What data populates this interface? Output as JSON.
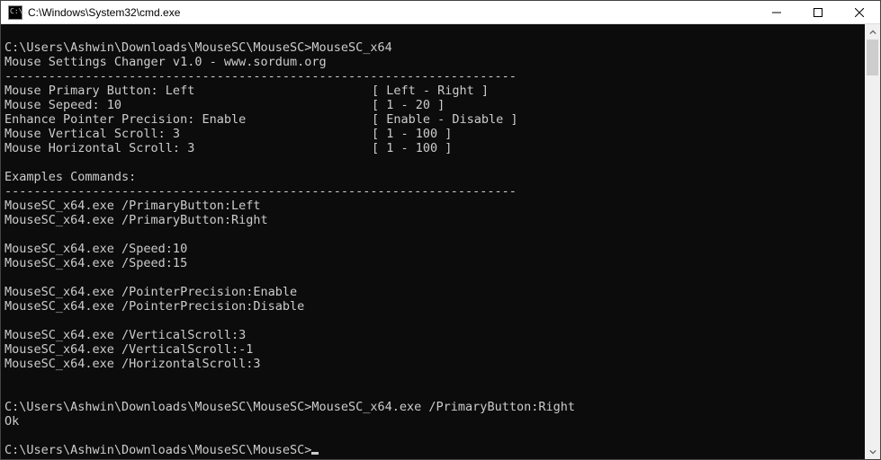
{
  "window": {
    "title": "C:\\Windows\\System32\\cmd.exe",
    "icon_glyph": "C:\\."
  },
  "console": {
    "prompt_path": "C:\\Users\\Ashwin\\Downloads\\MouseSC\\MouseSC>",
    "cmd1": "MouseSC_x64",
    "app_header": "Mouse Settings Changer v1.0 - www.sordum.org",
    "sep": "----------------------------------------------------------------------",
    "settings": {
      "primary": {
        "label": "Mouse Primary Button: Left",
        "range": "[ Left - Right ]"
      },
      "speed": {
        "label": "Mouse Sepeed: 10",
        "range": "[ 1 - 20 ]"
      },
      "precision": {
        "label": "Enhance Pointer Precision: Enable",
        "range": "[ Enable - Disable ]"
      },
      "vscroll": {
        "label": "Mouse Vertical Scroll: 3",
        "range": "[ 1 - 100 ]"
      },
      "hscroll": {
        "label": "Mouse Horizontal Scroll: 3",
        "range": "[ 1 - 100 ]"
      }
    },
    "examples_header": "Examples Commands:",
    "examples": {
      "e1": "MouseSC_x64.exe /PrimaryButton:Left",
      "e2": "MouseSC_x64.exe /PrimaryButton:Right",
      "e3": "MouseSC_x64.exe /Speed:10",
      "e4": "MouseSC_x64.exe /Speed:15",
      "e5": "MouseSC_x64.exe /PointerPrecision:Enable",
      "e6": "MouseSC_x64.exe /PointerPrecision:Disable",
      "e7": "MouseSC_x64.exe /VerticalScroll:3",
      "e8": "MouseSC_x64.exe /VerticalScroll:-1",
      "e9": "MouseSC_x64.exe /HorizontalScroll:3"
    },
    "cmd2": "MouseSC_x64.exe /PrimaryButton:Right",
    "cmd2_result": "Ok",
    "cursor_prompt": "C:\\Users\\Ashwin\\Downloads\\MouseSC\\MouseSC>"
  }
}
